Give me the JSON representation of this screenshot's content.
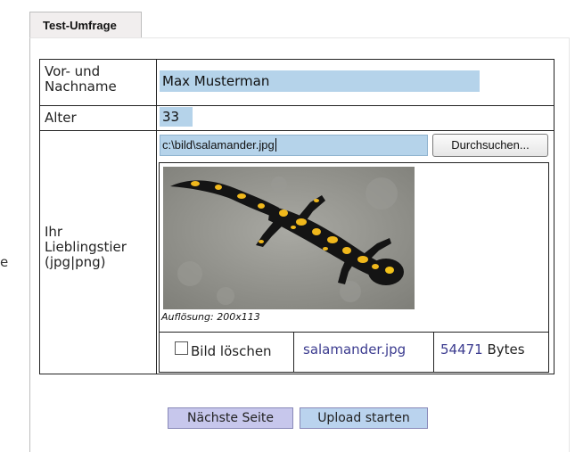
{
  "edge_text": "e",
  "tab": {
    "label": "Test-Umfrage"
  },
  "form": {
    "name": {
      "label_line1": "Vor- und",
      "label_line2": "Nachname",
      "value": "Max Musterman"
    },
    "age": {
      "label": "Alter",
      "value": "33"
    },
    "pet": {
      "label_line1": "Ihr",
      "label_line2": "Lieblingstier",
      "label_line3": "(jpg|png)",
      "file_path": "c:\\bild\\salamander.jpg",
      "browse_label": "Durchsuchen...",
      "resolution": "Auflösung: 200x113",
      "delete_label": "Bild löschen",
      "delete_checked": false,
      "file_name": "salamander.jpg",
      "file_size": "54471",
      "size_unit": "Bytes"
    }
  },
  "buttons": {
    "next_page": "Nächste Seite",
    "upload_start": "Upload starten"
  },
  "colors": {
    "input_background": "#b5d3ea",
    "next_button": "#c7c7ec",
    "upload_button": "#bad3ee",
    "link_text": "#3b3b8f"
  },
  "icons": {
    "checkbox": "checkbox-unchecked-icon",
    "image": "salamander-photo"
  }
}
